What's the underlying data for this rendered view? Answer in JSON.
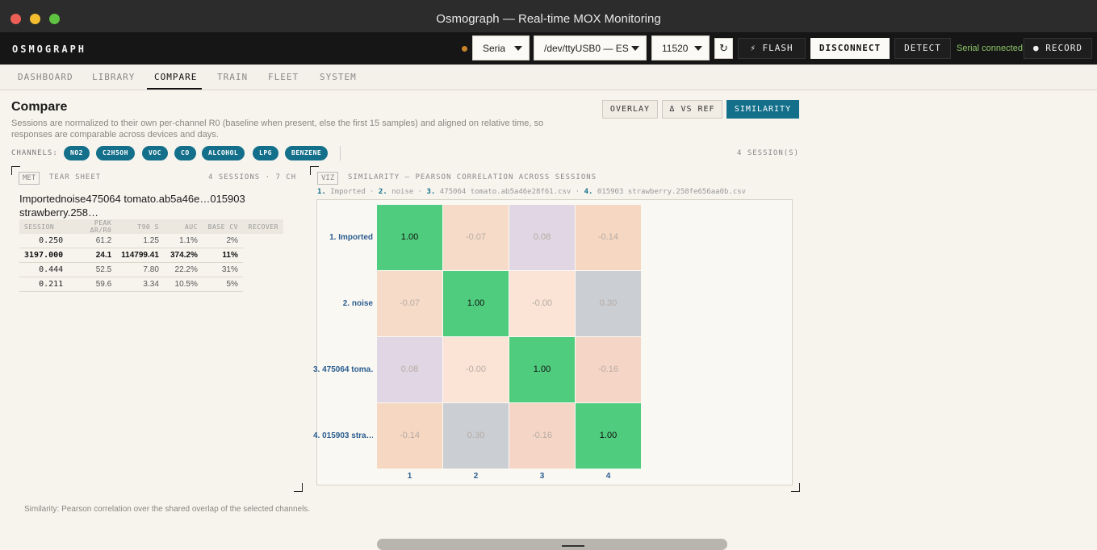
{
  "window": {
    "title": "Osmograph — Real-time MOX Monitoring"
  },
  "header": {
    "brand": "OSMOGRAPH",
    "transport": "Seria",
    "port": "/dev/ttyUSB0 — ES",
    "baud": "11520",
    "refresh_icon": "↻",
    "flash": "⚡ FLASH",
    "disconnect": "DISCONNECT",
    "detect": "DETECT",
    "status": "Serial connected",
    "record": "● RECORD",
    "status_color": "#8fc76b"
  },
  "nav": {
    "tabs": [
      "DASHBOARD",
      "LIBRARY",
      "COMPARE",
      "TRAIN",
      "FLEET",
      "SYSTEM"
    ],
    "active": "COMPARE"
  },
  "compare": {
    "title": "Compare",
    "description": "Sessions are normalized to their own per-channel R0 (baseline when present, else the first 15 samples) and aligned on relative time, so responses are comparable across devices and days.",
    "modes": [
      "OVERLAY",
      "Δ VS REF",
      "SIMILARITY"
    ],
    "active_mode": "SIMILARITY",
    "channels_label": "CHANNELS:",
    "channels": [
      "NO2",
      "C2H5OH",
      "VOC",
      "CO",
      "ALCOHOL",
      "LPG",
      "BENZENE"
    ],
    "session_count": "4 SESSION(S)"
  },
  "tearsheet": {
    "tag": "MET",
    "title": "TEAR SHEET",
    "meta": "4 SESSIONS · 7 CH",
    "name": "Importednoise475064 tomato.ab5a46e…015903 strawberry.258…",
    "columns": [
      "SESSION",
      "PEAK ΔR/R0",
      "T90 S",
      "AUC",
      "BASE CV",
      "RECOVER"
    ],
    "rows": [
      [
        "0.250",
        "61.2",
        "1.25",
        "1.1%",
        "2%",
        ""
      ],
      [
        "3197.000",
        "24.1",
        "114799.41",
        "374.2%",
        "11%",
        ""
      ],
      [
        "0.444",
        "52.5",
        "7.80",
        "22.2%",
        "31%",
        ""
      ],
      [
        "0.211",
        "59.6",
        "3.34",
        "10.5%",
        "5%",
        ""
      ]
    ]
  },
  "similarity": {
    "tag": "VIZ",
    "title": "SIMILARITY — PEARSON CORRELATION ACROSS SESSIONS",
    "legend": [
      {
        "n": "1.",
        "label": "Imported"
      },
      {
        "n": "2.",
        "label": "noise"
      },
      {
        "n": "3.",
        "label": "475064 tomato.ab5a46e28f61.csv"
      },
      {
        "n": "4.",
        "label": "015903 strawberry.258fe656aa0b.csv"
      }
    ],
    "row_labels": [
      "1. Imported",
      "2. noise",
      "3. 475064 toma…",
      "4. 015903 stra…"
    ],
    "col_labels": [
      "1",
      "2",
      "3",
      "4"
    ],
    "matrix": [
      [
        "1.00",
        "-0.07",
        "0.08",
        "-0.14"
      ],
      [
        "-0.07",
        "1.00",
        "-0.00",
        "0.30"
      ],
      [
        "0.08",
        "-0.00",
        "1.00",
        "-0.16"
      ],
      [
        "-0.14",
        "0.30",
        "-0.16",
        "1.00"
      ]
    ],
    "colors": [
      [
        "#4fcc7d",
        "#f6dcc8",
        "#e1d6e3",
        "#f6d7c2"
      ],
      [
        "#f6dcc8",
        "#4fcc7d",
        "#fbe4d5",
        "#cbced3"
      ],
      [
        "#e1d6e3",
        "#fbe4d5",
        "#4fcc7d",
        "#f5d6c6"
      ],
      [
        "#f6d7c2",
        "#cbced3",
        "#f5d6c6",
        "#4fcc7d"
      ]
    ],
    "footnote": "Similarity: Pearson correlation over the shared overlap of the selected channels."
  }
}
